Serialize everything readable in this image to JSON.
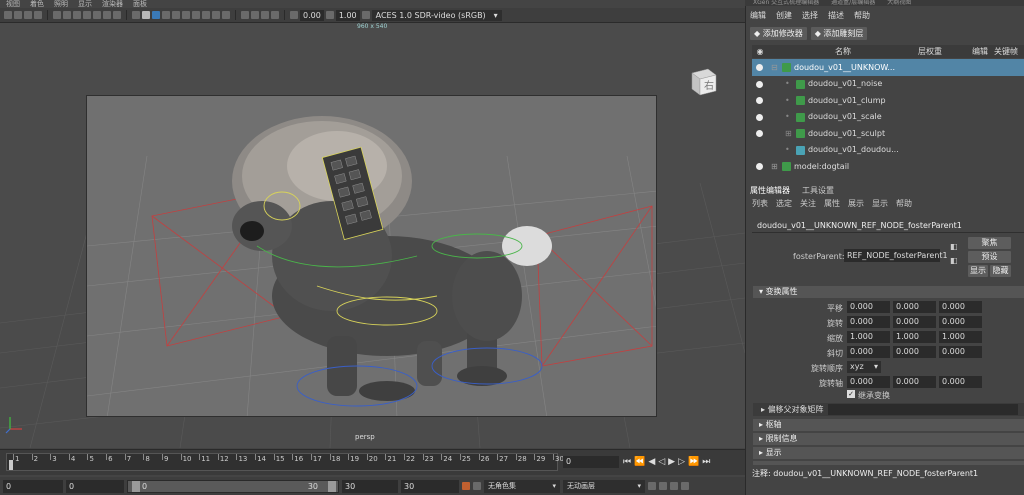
{
  "menubar": {
    "items": [
      "视图",
      "着色",
      "照明",
      "显示",
      "渲染器",
      "面板"
    ]
  },
  "toolbar": {
    "field_a": "0.00",
    "field_b": "1.00",
    "color_space": "ACES 1.0 SDR-video (sRGB)"
  },
  "viewport": {
    "resolution": "960 x 540",
    "camera": "persp",
    "viewcube_face": "右"
  },
  "timeline": {
    "ticks": [
      "1",
      "2",
      "3",
      "4",
      "5",
      "6",
      "7",
      "8",
      "9",
      "10",
      "11",
      "12",
      "13",
      "14",
      "15",
      "16",
      "17",
      "18",
      "19",
      "20",
      "21",
      "22",
      "23",
      "24",
      "25",
      "26",
      "27",
      "28",
      "29",
      "30"
    ],
    "current_frame": "0"
  },
  "rangebar": {
    "start_a": "0",
    "start_b": "0",
    "slider_start": "0",
    "slider_end": "30",
    "end_a": "30",
    "end_b": "30",
    "character_set": "无角色集",
    "anim_layer": "无动画层"
  },
  "xgen": {
    "tabs": [
      "XGen 交互式梳理编辑器",
      "通道盒/层编辑器",
      "大纲视图"
    ],
    "menu": [
      "编辑",
      "创建",
      "选择",
      "描述",
      "帮助"
    ],
    "add_modifier": "添加修改器",
    "add_layer": "添加雕刻层",
    "col_name": "名称",
    "col_weight": "层权重",
    "col_edit": "编辑",
    "col_key": "关键帧",
    "rows": [
      {
        "label": "doudou_v01__UNKNOW..."
      },
      {
        "label": "doudou_v01_noise"
      },
      {
        "label": "doudou_v01_clump"
      },
      {
        "label": "doudou_v01_scale"
      },
      {
        "label": "doudou_v01_sculpt"
      },
      {
        "label": "doudou_v01_doudou..."
      },
      {
        "label": "model:dogtail"
      }
    ]
  },
  "attr_editor": {
    "tabs": [
      "属性编辑器",
      "工具设置"
    ],
    "menu": [
      "列表",
      "选定",
      "关注",
      "属性",
      "展示",
      "显示",
      "帮助"
    ],
    "node_name": "doudou_v01__UNKNOWN_REF_NODE_fosterParent1",
    "foster_label": "fosterParent:",
    "foster_value": "REF_NODE_fosterParent1",
    "btn_focus": "聚焦",
    "btn_preset": "预设",
    "btn_show": "显示",
    "btn_hide": "隐藏",
    "transform_section": "变换属性",
    "translate": {
      "label": "平移",
      "x": "0.000",
      "y": "0.000",
      "z": "0.000"
    },
    "rotate": {
      "label": "旋转",
      "x": "0.000",
      "y": "0.000",
      "z": "0.000"
    },
    "scale": {
      "label": "缩放",
      "x": "1.000",
      "y": "1.000",
      "z": "1.000"
    },
    "shear": {
      "label": "斜切",
      "x": "0.000",
      "y": "0.000",
      "z": "0.000"
    },
    "rotate_order_label": "旋转顺序",
    "rotate_order_value": "xyz",
    "rotate_axis": {
      "label": "旋转轴",
      "x": "0.000",
      "y": "0.000",
      "z": "0.000"
    },
    "inherit_label": "继承变换",
    "offset_parent": "偏移父对象矩阵",
    "sect_pivot": "枢轴",
    "sect_limit": "限制信息",
    "sect_display": "显示",
    "notes_label": "注释:",
    "notes_value": "doudou_v01__UNKNOWN_REF_NODE_fosterParent1"
  },
  "colors": {
    "selection": "#5285a6",
    "viewport_bg": "#707070",
    "xgen_green": "#3f9a4a"
  }
}
